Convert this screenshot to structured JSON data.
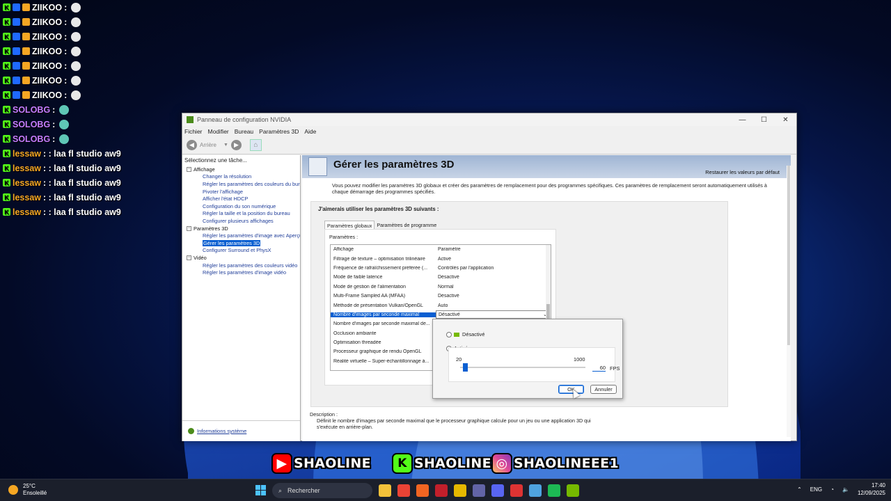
{
  "chat": [
    {
      "badges": [
        "k",
        "v",
        "s"
      ],
      "user": "ZIIKOO",
      "user_color": "#ffffff",
      "message": ":",
      "emote": "white"
    },
    {
      "badges": [
        "k",
        "v",
        "s"
      ],
      "user": "ZIIKOO",
      "user_color": "#ffffff",
      "message": ":",
      "emote": "white"
    },
    {
      "badges": [
        "k",
        "v",
        "s"
      ],
      "user": "ZIIKOO",
      "user_color": "#ffffff",
      "message": ":",
      "emote": "white"
    },
    {
      "badges": [
        "k",
        "v",
        "s"
      ],
      "user": "ZIIKOO",
      "user_color": "#ffffff",
      "message": ":",
      "emote": "white"
    },
    {
      "badges": [
        "k",
        "v",
        "s"
      ],
      "user": "ZIIKOO",
      "user_color": "#ffffff",
      "message": ":",
      "emote": "white"
    },
    {
      "badges": [
        "k",
        "v",
        "s"
      ],
      "user": "ZIIKOO",
      "user_color": "#ffffff",
      "message": ":",
      "emote": "white"
    },
    {
      "badges": [
        "k",
        "v",
        "s"
      ],
      "user": "ZIIKOO",
      "user_color": "#ffffff",
      "message": ":",
      "emote": "white"
    },
    {
      "badges": [
        "k"
      ],
      "user": "SOLOBG",
      "user_color": "#c77dff",
      "message": ":",
      "emote": "teal"
    },
    {
      "badges": [
        "k"
      ],
      "user": "SOLOBG",
      "user_color": "#c77dff",
      "message": ":",
      "emote": "teal"
    },
    {
      "badges": [
        "k"
      ],
      "user": "SOLOBG",
      "user_color": "#c77dff",
      "message": ":",
      "emote": "teal"
    },
    {
      "badges": [
        "k"
      ],
      "user": "lessaw",
      "user_color": "#f5a623",
      "message": ": : laa fl studio aw9",
      "emote": ""
    },
    {
      "badges": [
        "k"
      ],
      "user": "lessaw",
      "user_color": "#f5a623",
      "message": ": : laa fl studio aw9",
      "emote": ""
    },
    {
      "badges": [
        "k"
      ],
      "user": "lessaw",
      "user_color": "#f5a623",
      "message": ": : laa fl studio aw9",
      "emote": ""
    },
    {
      "badges": [
        "k"
      ],
      "user": "lessaw",
      "user_color": "#f5a623",
      "message": ": : laa fl studio aw9",
      "emote": ""
    },
    {
      "badges": [
        "k"
      ],
      "user": "lessaw",
      "user_color": "#f5a623",
      "message": ": : laa fl studio aw9",
      "emote": ""
    }
  ],
  "window": {
    "title": "Panneau de configuration NVIDIA",
    "menu": [
      "Fichier",
      "Modifier",
      "Bureau",
      "Paramètres 3D",
      "Aide"
    ],
    "toolbar": {
      "back_label": "Arrière"
    },
    "left": {
      "title": "Sélectionnez une tâche...",
      "categories": [
        {
          "label": "Affichage",
          "items": [
            "Changer la résolution",
            "Régler les paramètres des couleurs du bureau",
            "Pivoter l'affichage",
            "Afficher l'état HDCP",
            "Configuration du son numérique",
            "Régler la taille et la position du bureau",
            "Configurer plusieurs affichages"
          ]
        },
        {
          "label": "Paramètres 3D",
          "items": [
            "Régler les paramètres d'image avec Aperçu",
            "Gérer les paramètres 3D",
            "Configurer Surround et PhysX"
          ]
        },
        {
          "label": "Vidéo",
          "items": [
            "Régler les paramètres des couleurs vidéo",
            "Régler les paramètres d'image vidéo"
          ]
        }
      ],
      "selected": "Gérer les paramètres 3D",
      "footer_link": "Informations système"
    },
    "main": {
      "header_title": "Gérer les paramètres 3D",
      "restore_link": "Restaurer les valeurs par défaut",
      "intro": "Vous pouvez modifier les paramètres 3D globaux et créer des paramètres de remplacement pour des programmes spécifiques. Ces paramètres de remplacement seront automatiquement utilisés à chaque démarrage des programmes spécifiés.",
      "group_title": "J'aimerais utiliser les paramètres 3D suivants :",
      "tabs": [
        "Paramètres globaux",
        "Paramètres de programme"
      ],
      "params_label": "Paramètres :",
      "table_header": {
        "c1": "Affichage",
        "c2": "Paramètre"
      },
      "rows": [
        {
          "name": "Filtrage de texture – optimisation trilinéaire",
          "value": "Activé"
        },
        {
          "name": "Fréquence de rafraîchissement préférée (...",
          "value": "Contrôlés par l'application"
        },
        {
          "name": "Mode de faible latence",
          "value": "Désactivé"
        },
        {
          "name": "Mode de gestion de l'alimentation",
          "value": "Normal"
        },
        {
          "name": "Multi-Frame Sampled AA (MFAA)",
          "value": "Désactivé"
        },
        {
          "name": "Méthode de présentation Vulkan/OpenGL",
          "value": "Auto"
        },
        {
          "name": "Nombre d'images par seconde maximal",
          "value": "Désactivé",
          "selected": true
        },
        {
          "name": "Nombre d'images par seconde maximal de...",
          "value": ""
        },
        {
          "name": "Occlusion ambiante",
          "value": ""
        },
        {
          "name": "Optimisation threadée",
          "value": ""
        },
        {
          "name": "Processeur graphique de rendu OpenGL",
          "value": ""
        },
        {
          "name": "Réalité virtuelle – Super-échantillonnage à...",
          "value": ""
        }
      ],
      "description_label": "Description :",
      "description_text": "Définit le nombre d'images par seconde maximal que le processeur graphique calcule pour un jeu ou une application 3D qui s'exécute en arrière-plan."
    },
    "popup": {
      "option_off": "Désactivé",
      "option_on": "Activé",
      "selected_option": "Activé",
      "slider_min": "20",
      "slider_max": "1000",
      "fps_value": "60",
      "fps_unit": "FPS",
      "slider": {
        "min": 20,
        "max": 1000,
        "value": 60
      },
      "ok_label": "OK",
      "cancel_label": "Annuler"
    }
  },
  "watermark": [
    {
      "icon": "youtube-icon",
      "label": "SHAOLINE"
    },
    {
      "icon": "kick-icon",
      "label": "SHAOLINE"
    },
    {
      "icon": "instagram-icon",
      "label": "SHAOLINEEE1"
    }
  ],
  "taskbar": {
    "weather_temp": "25°C",
    "weather_desc": "Ensoleillé",
    "search_placeholder": "Rechercher",
    "lang": "ENG",
    "time": "17:40",
    "date": "12/09/2025",
    "pinned": [
      {
        "icon": "file-explorer-icon",
        "color": "#f3c13a"
      },
      {
        "icon": "chrome-icon",
        "color": "#ea4335"
      },
      {
        "icon": "app-orange-icon",
        "color": "#f26522"
      },
      {
        "icon": "app-red-icon",
        "color": "#c21f2b"
      },
      {
        "icon": "app-yellow-icon",
        "color": "#e6b800"
      },
      {
        "icon": "teams-icon",
        "color": "#6264a7"
      },
      {
        "icon": "discord-icon",
        "color": "#5865f2"
      },
      {
        "icon": "app-globe-icon",
        "color": "#d33"
      },
      {
        "icon": "notepad-icon",
        "color": "#4fa3e0"
      },
      {
        "icon": "spotify-icon",
        "color": "#1db954"
      },
      {
        "icon": "nvidia-icon",
        "color": "#76b900"
      }
    ]
  }
}
